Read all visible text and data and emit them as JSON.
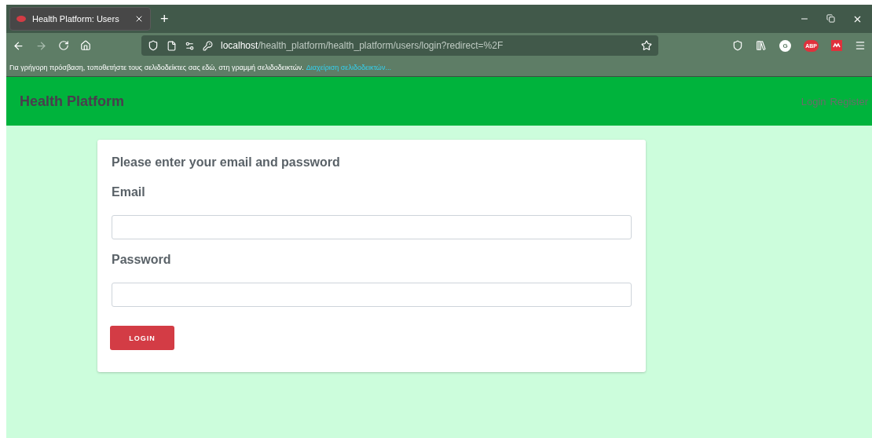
{
  "browser": {
    "tabs": [
      {
        "title": "Health Platform: Users",
        "selected": true
      }
    ],
    "new_tab": "+",
    "address": {
      "host": "localhost",
      "path": "/health_platform/health_platform/users/login?redirect=%2F"
    },
    "extensions": [
      {
        "kind": "grammar",
        "label": "G"
      },
      {
        "kind": "adblock",
        "label": "ABP"
      }
    ],
    "bookmarks_bar": {
      "message": "Για γρήγορη πρόσβαση, τοποθετήστε τους σελιδοδείκτες σας εδώ, στη γραμμή σελιδοδεικτών.",
      "link": "Διαχείριση σελιδοδεικτών..."
    }
  },
  "navbar": {
    "brand": "Health Platform",
    "links": [
      "Login",
      "Register"
    ]
  },
  "form": {
    "heading": "Please enter your email and password",
    "fields": [
      {
        "label": "Email"
      },
      {
        "label": "Password"
      }
    ],
    "submit": "LOGIN"
  }
}
